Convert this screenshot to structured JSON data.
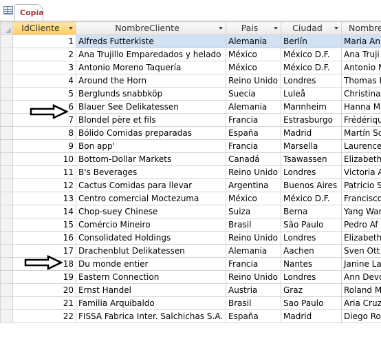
{
  "window": {
    "tab_title": "Copia"
  },
  "table": {
    "columns": [
      "IdCliente",
      "NombreCliente",
      "Pais",
      "Ciudad",
      "Nombre"
    ],
    "rows": [
      [
        "1",
        "Alfreds Futterkiste",
        "Alemania",
        "Berlín",
        "Maria An"
      ],
      [
        "2",
        "Ana Trujillo Emparedados y helado",
        "México",
        "México D.F.",
        "Ana Truji"
      ],
      [
        "3",
        "Antonio Moreno Taquería",
        "México",
        "México D.F.",
        "Antonio M"
      ],
      [
        "4",
        "Around the Horn",
        "Reino Unido",
        "Londres",
        "Thomas H"
      ],
      [
        "5",
        "Berglunds snabbköp",
        "Suecia",
        "Luleå",
        "Christina"
      ],
      [
        "6",
        "Blauer See Delikatessen",
        "Alemania",
        "Mannheim",
        "Hanna M"
      ],
      [
        "7",
        "Blondel père et fils",
        "Francia",
        "Estrasburgo",
        "Frédériqu"
      ],
      [
        "8",
        "Bólido Comidas preparadas",
        "España",
        "Madrid",
        "Martín Sc"
      ],
      [
        "9",
        "Bon app'",
        "Francia",
        "Marsella",
        "Laurence"
      ],
      [
        "10",
        "Bottom-Dollar Markets",
        "Canadá",
        "Tsawassen",
        "Elizabeth"
      ],
      [
        "11",
        "B's Beverages",
        "Reino Unido",
        "Londres",
        "Victoria A"
      ],
      [
        "12",
        "Cactus Comidas para llevar",
        "Argentina",
        "Buenos Aires",
        "Patricio S"
      ],
      [
        "13",
        "Centro comercial Moctezuma",
        "México",
        "México D.F.",
        "Francisco"
      ],
      [
        "14",
        "Chop-suey Chinese",
        "Suiza",
        "Berna",
        "Yang War"
      ],
      [
        "15",
        "Comércio Mineiro",
        "Brasil",
        "São Paulo",
        "Pedro Af"
      ],
      [
        "16",
        "Consolidated Holdings",
        "Reino Unido",
        "Londres",
        "Elizabeth"
      ],
      [
        "17",
        "Drachenblut Delikatessen",
        "Alemania",
        "Aachen",
        "Sven Ott"
      ],
      [
        "18",
        "Du monde entier",
        "Francia",
        "Nantes",
        "Janine La"
      ],
      [
        "19",
        "Eastern Connection",
        "Reino Unido",
        "Londres",
        "Ann Devo"
      ],
      [
        "20",
        "Ernst Handel",
        "Austria",
        "Graz",
        "Roland M"
      ],
      [
        "21",
        "Familia Arquibaldo",
        "Brasil",
        "Sao Paulo",
        "Aria Cruz"
      ],
      [
        "22",
        "FISSA Fabrica Inter. Salchichas S.A.",
        "España",
        "Madrid",
        "Diego Ro"
      ]
    ]
  }
}
